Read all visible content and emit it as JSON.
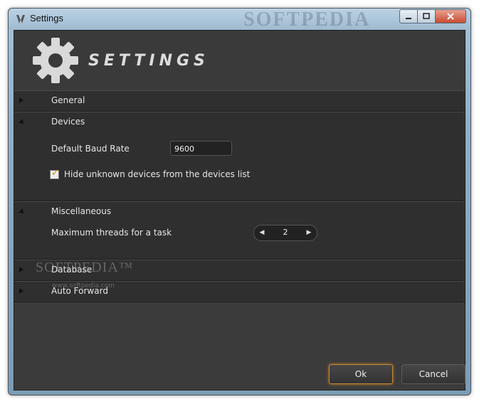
{
  "window": {
    "title": "Settings",
    "watermark_title": "SOFTPEDIA"
  },
  "header": {
    "brand_text": "SETTINGS",
    "icon": "gear-icon"
  },
  "sections": {
    "general": {
      "label": "General",
      "expanded": false
    },
    "devices": {
      "label": "Devices",
      "expanded": true,
      "baud_label": "Default Baud Rate",
      "baud_value": "9600",
      "hide_unknown_label": "Hide unknown devices from the devices list",
      "hide_unknown_checked": true
    },
    "misc": {
      "label": "Miscellaneous",
      "expanded": true,
      "threads_label": "Maximum threads for a task",
      "threads_value": "2"
    },
    "database": {
      "label": "Database",
      "expanded": false
    },
    "auto_forward": {
      "label": "Auto Forward",
      "expanded": false
    }
  },
  "buttons": {
    "ok": "Ok",
    "cancel": "Cancel"
  },
  "watermark": {
    "text": "SOFTPEDIA™",
    "url": "www.softpedia.com"
  },
  "colors": {
    "accent": "#d58a00",
    "panel": "#2f2f2f",
    "background": "#3b3b3b"
  }
}
